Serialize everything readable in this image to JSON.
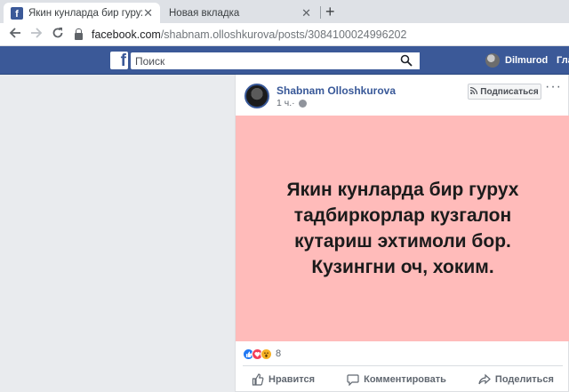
{
  "browser": {
    "tabs": [
      {
        "title": "Якин кунларда бир гурух тадби"
      },
      {
        "title": "Новая вкладка"
      }
    ],
    "close_glyph": "✕",
    "new_tab_glyph": "+",
    "url_host": "facebook.com",
    "url_path": "/shabnam.olloshkurova/posts/3084100024996202"
  },
  "facebook": {
    "logo": "f",
    "search_placeholder": "Поиск",
    "profile_name": "Dilmurod",
    "home_label": "Гла"
  },
  "post": {
    "author": "Shabnam Olloshkurova",
    "time": "1 ч.",
    "separator": " · ",
    "subscribe_label": "Подписаться",
    "more_glyph": "···",
    "text": "Якин кунларда бир гурух тадбиркорлар кузгалон кутариш эхтимоли бор. Кузингни оч, хоким.",
    "image_background": "#ffbbba",
    "reactions": [
      "like-icon",
      "love-icon",
      "wow-icon"
    ],
    "reaction_count": "8",
    "actions": {
      "like": "Нравится",
      "comment": "Комментировать",
      "share": "Поделиться"
    }
  },
  "colors": {
    "facebook_blue": "#3b5998",
    "link_blue": "#385898"
  }
}
